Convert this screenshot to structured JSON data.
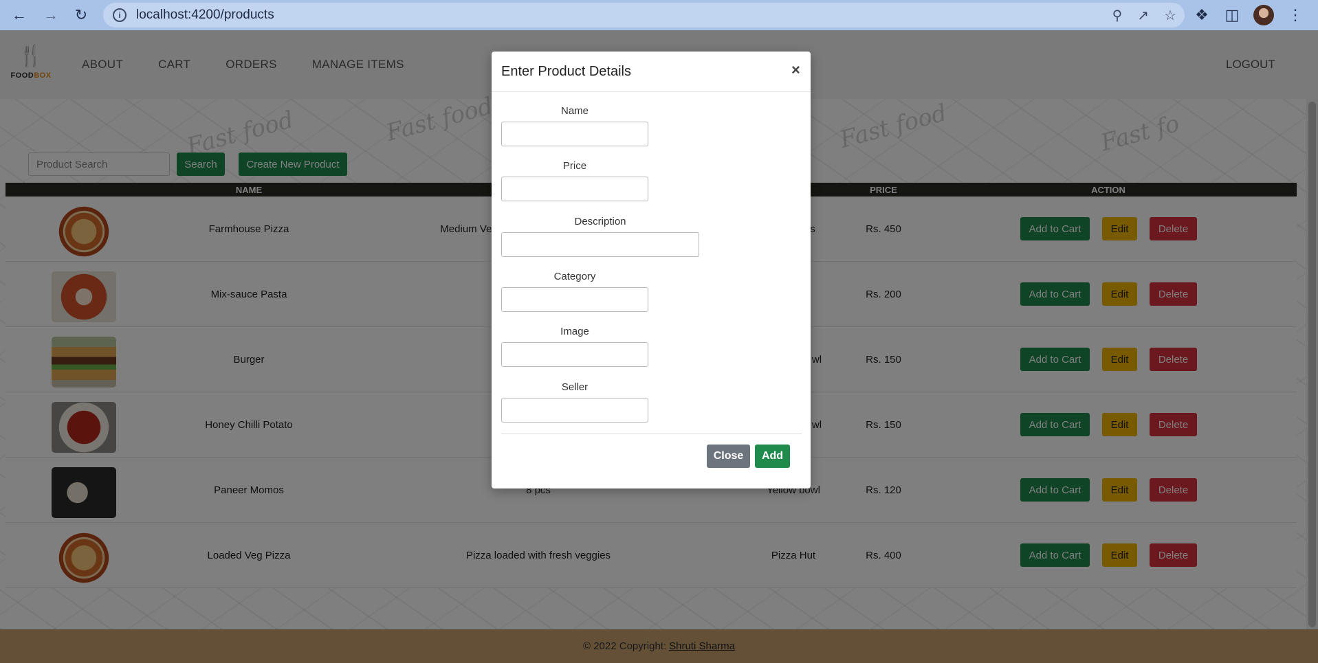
{
  "browser": {
    "url": "localhost:4200/products",
    "icons": [
      "back-icon",
      "forward-icon",
      "reload-icon",
      "info-icon",
      "zoom-icon",
      "share-icon",
      "star-icon",
      "extensions-icon",
      "sidepanel-icon",
      "profile-avatar",
      "menu-icon"
    ]
  },
  "navbar": {
    "logo_text": "FOOD",
    "logo_text_accent": "BOX",
    "menu": [
      "ABOUT",
      "CART",
      "ORDERS",
      "MANAGE ITEMS"
    ],
    "logout": "LOGOUT"
  },
  "toolbar": {
    "search_placeholder": "Product Search",
    "search_button": "Search",
    "create_button": "Create New Product"
  },
  "table": {
    "headers": [
      "NAME",
      "PRICE",
      "ACTION"
    ],
    "rows": [
      {
        "name": "Farmhouse Pizza",
        "description": "Medium Veg",
        "seller": "s",
        "price": "Rs. 450"
      },
      {
        "name": "Mix-sauce Pasta",
        "description": "",
        "seller": "",
        "price": "Rs. 200"
      },
      {
        "name": "Burger",
        "description": "",
        "seller": "wl",
        "price": "Rs. 150"
      },
      {
        "name": "Honey Chilli Potato",
        "description": "",
        "seller": "wl",
        "price": "Rs. 150"
      },
      {
        "name": "Paneer Momos",
        "description": "8 pcs",
        "seller": "Yellow bowl",
        "price": "Rs. 120"
      },
      {
        "name": "Loaded Veg Pizza",
        "description": "Pizza loaded with fresh veggies",
        "seller": "Pizza Hut",
        "price": "Rs. 400"
      }
    ],
    "actions": {
      "add_to_cart": "Add to Cart",
      "edit": "Edit",
      "delete": "Delete"
    }
  },
  "footer": {
    "text": "© 2022 Copyright:",
    "author": "Shruti Sharma"
  },
  "modal": {
    "title": "Enter Product Details",
    "close_symbol": "×",
    "fields": {
      "name": "Name",
      "price": "Price",
      "description": "Description",
      "category": "Category",
      "image": "Image",
      "seller": "Seller"
    },
    "close_button": "Close",
    "add_button": "Add"
  },
  "colors": {
    "primary_green": "#1e8a4c",
    "warning_yellow": "#f0b400",
    "danger_red": "#d9303e",
    "footer_tan": "#c8a16e",
    "chrome_blue": "#a9c3e8"
  }
}
